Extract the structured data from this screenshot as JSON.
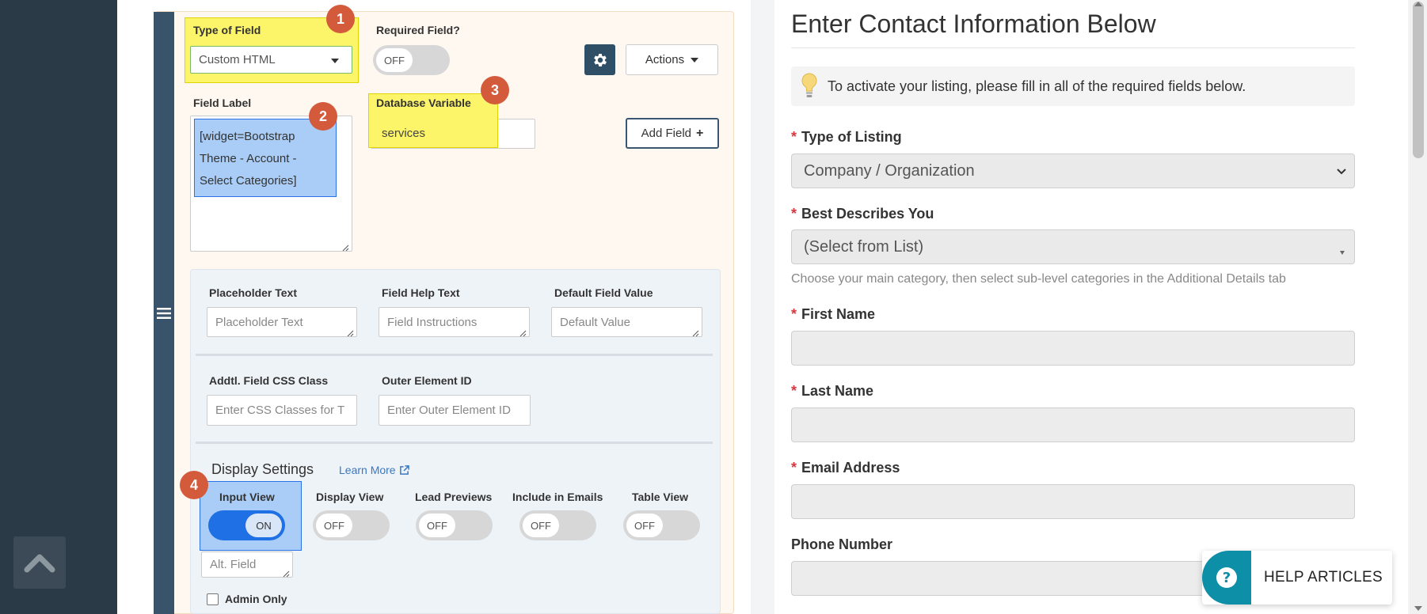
{
  "editor": {
    "type_of_field_label": "Type of Field",
    "type_of_field_value": "Custom HTML",
    "required_field_label": "Required Field?",
    "required_toggle": "OFF",
    "actions_label": "Actions",
    "field_label_label": "Field Label",
    "field_label_value": "[widget=Bootstrap Theme - Account - Select Categories]",
    "db_var_label": "Database Variable",
    "db_var_value": "services",
    "add_field_label": "Add Field",
    "add_field_plus": "+",
    "placeholder_text_label": "Placeholder Text",
    "placeholder_text_ph": "Placeholder Text",
    "field_help_label": "Field Help Text",
    "field_help_ph": "Field Instructions",
    "default_value_label": "Default Field Value",
    "default_value_ph": "Default Value",
    "css_class_label": "Addtl. Field CSS Class",
    "css_class_ph": "Enter CSS Classes for T",
    "outer_id_label": "Outer Element ID",
    "outer_id_ph": "Enter Outer Element ID",
    "display_settings_title": "Display Settings",
    "learn_more": "Learn More",
    "views": [
      {
        "label": "Input View",
        "state": "ON"
      },
      {
        "label": "Display View",
        "state": "OFF"
      },
      {
        "label": "Lead Previews",
        "state": "OFF"
      },
      {
        "label": "Include in Emails",
        "state": "OFF"
      },
      {
        "label": "Table View",
        "state": "OFF"
      }
    ],
    "alt_field_ph": "Alt. Field",
    "admin_only_label": "Admin Only"
  },
  "badges": [
    "1",
    "2",
    "3",
    "4"
  ],
  "form": {
    "title": "Enter Contact Information Below",
    "notice": "To activate your listing, please fill in all of the required fields below.",
    "required_mark": "*",
    "type_of_listing_label": "Type of Listing",
    "type_of_listing_value": "Company / Organization",
    "best_describes_label": "Best Describes You",
    "best_describes_value": "(Select from List)",
    "category_help": "Choose your main category, then select sub-level categories in the Additional Details tab",
    "first_name_label": "First Name",
    "last_name_label": "Last Name",
    "email_label": "Email Address",
    "phone_label": "Phone Number"
  },
  "help_widget": {
    "label": "HELP ARTICLES",
    "icon_glyph": "?"
  },
  "colors": {
    "highlight_yellow": "#fcf56a",
    "highlight_blue": "#a9cdf7",
    "badge": "#d45a3c",
    "toggle_on": "#1f6fe5",
    "help_teal": "#0e8fa8"
  }
}
